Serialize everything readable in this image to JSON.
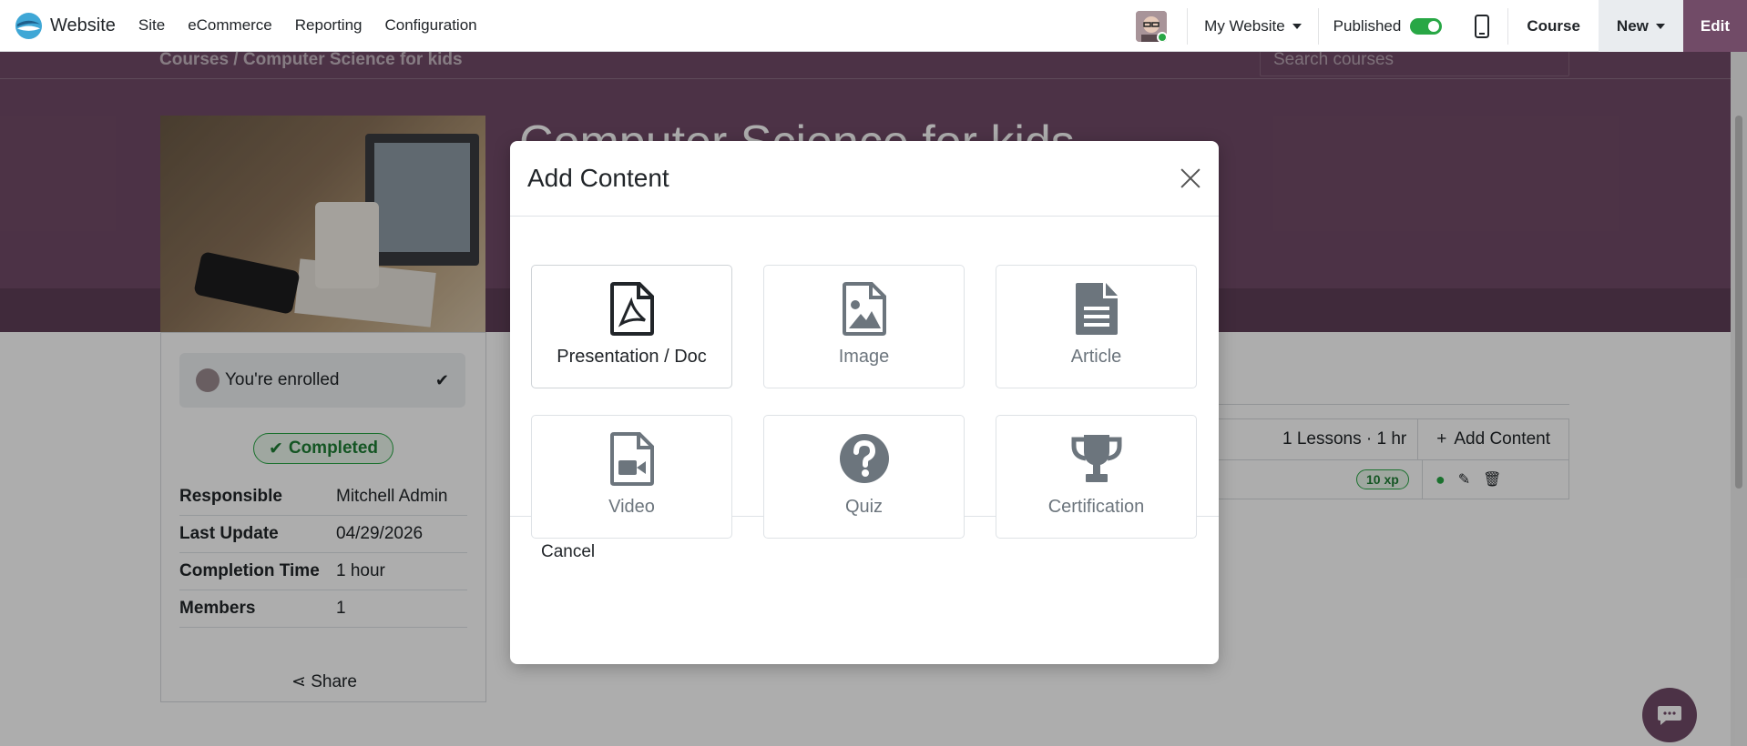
{
  "navbar": {
    "brand": "Website",
    "menu": [
      "Site",
      "eCommerce",
      "Reporting",
      "Configuration"
    ],
    "website_selector": "My Website",
    "published_label": "Published",
    "course_label": "Course",
    "new_label": "New",
    "edit_label": "Edit"
  },
  "page": {
    "breadcrumb": "Courses  /  Computer Science for kids",
    "search_placeholder": "Search courses",
    "course_title": "Computer Science for kids",
    "enrolled_text": "You're enrolled",
    "completed_badge": "Completed",
    "info": [
      {
        "key": "Responsible",
        "value": "Mitchell Admin"
      },
      {
        "key": "Last Update",
        "value": "04/29/2026"
      },
      {
        "key": "Completion Time",
        "value": "1 hour"
      },
      {
        "key": "Members",
        "value": "1"
      }
    ],
    "share_label": "Share",
    "lessons_count": "1 Lessons · 1 hr",
    "add_content_label": "Add Content",
    "xp_badge": "10 xp"
  },
  "modal": {
    "title": "Add Content",
    "options": [
      {
        "label": "Presentation / Doc",
        "icon": "file-pdf-icon"
      },
      {
        "label": "Image",
        "icon": "file-image-icon"
      },
      {
        "label": "Article",
        "icon": "file-text-icon"
      },
      {
        "label": "Video",
        "icon": "file-video-icon"
      },
      {
        "label": "Quiz",
        "icon": "question-circle-icon"
      },
      {
        "label": "Certification",
        "icon": "trophy-icon"
      }
    ],
    "cancel_label": "Cancel"
  },
  "colors": {
    "brand_purple": "#714b67",
    "success_green": "#28a745",
    "icon_grey": "#6c757d"
  }
}
